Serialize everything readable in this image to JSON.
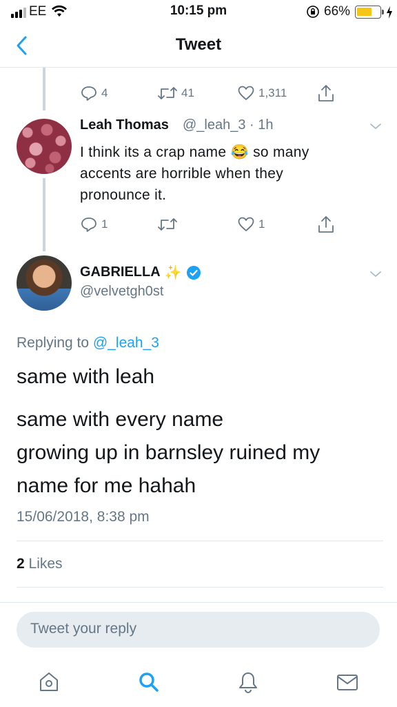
{
  "status_bar": {
    "carrier": "EE",
    "time": "10:15 pm",
    "battery_pct": "66%",
    "battery_level": 0.66
  },
  "nav": {
    "title": "Tweet"
  },
  "parent_tweet": {
    "reply_count": "4",
    "retweet_count": "41",
    "like_count": "1,311"
  },
  "reply_tweet": {
    "name": "Leah Thomas",
    "handle": "@_leah_3",
    "time_sep": "·",
    "time": "1h",
    "text_before": "I think its a crap name",
    "emoji": "😂",
    "text_after": "so many accents are horrible when they pronounce it.",
    "reply_count": "1",
    "like_count": "1"
  },
  "main_tweet": {
    "name": "GABRIELLA",
    "sparkle": "✨",
    "handle": "@velvetgh0st",
    "replying_prefix": "Replying to",
    "replying_to": "@_leah_3",
    "line1": "same with leah",
    "line2": "same with every name",
    "line3": "growing up in barnsley ruined my",
    "line4": "name for me hahah",
    "date": "15/06/2018, 8:38 pm",
    "likes_count": "2",
    "likes_label": "Likes"
  },
  "reply_bar": {
    "placeholder": "Tweet your reply"
  },
  "colors": {
    "accent": "#1da1f2",
    "muted": "#657786",
    "battery": "#f5c518"
  }
}
